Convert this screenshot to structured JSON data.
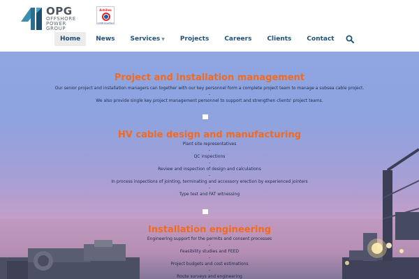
{
  "logo": {
    "abbr": "OPG",
    "line1": "OFFSHORE",
    "line2": "POWER",
    "line3": "GROUP"
  },
  "badge": {
    "top": "Achilles",
    "bottom": "UVDB Qualified"
  },
  "nav": {
    "items": [
      {
        "label": "Home",
        "active": true
      },
      {
        "label": "News"
      },
      {
        "label": "Services"
      },
      {
        "label": "Projects"
      },
      {
        "label": "Careers"
      },
      {
        "label": "Clients"
      },
      {
        "label": "Contact"
      }
    ],
    "search_icon": "search-icon"
  },
  "colors": {
    "accent": "#f26a1f",
    "nav_text": "#1d4f7a",
    "body_text": "#1d2a4a"
  },
  "sections": [
    {
      "title": "Project and installation management",
      "lines": [
        "Our senior project and installation managers can together with our key personnel form a complete project team to manage a subsea cable project.",
        "We also provide single key project management personnel to support and strengthen clients' project teams."
      ]
    },
    {
      "title": "HV cable design and manufacturing",
      "lines": [
        "Plant site representatives",
        "QC inspections",
        "Review and inspection of design and calculations",
        "In process inspections of jointing, terminating and accessory erection by experienced jointers",
        "Type test and FAT witnessing"
      ]
    },
    {
      "title": "Installation engineering",
      "lines": [
        "Engineering support for the permits and consent processes",
        "Feasibility studies and FEED",
        "Project budgets and cost estimations",
        "Route surveys and engineering"
      ]
    }
  ],
  "separator": "-"
}
